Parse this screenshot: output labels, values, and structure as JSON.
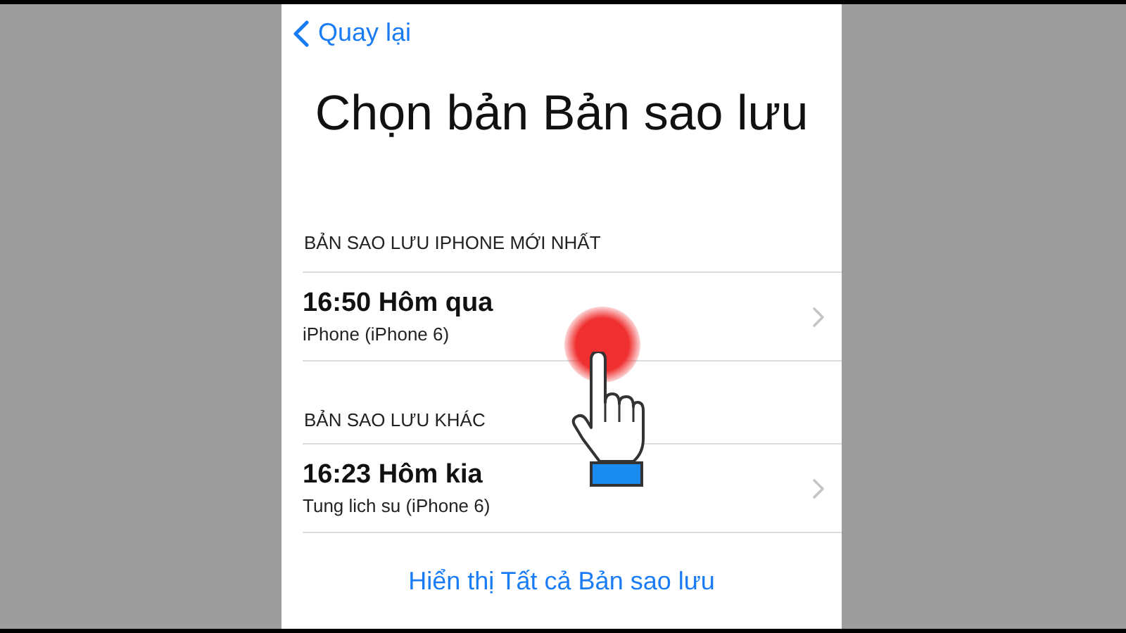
{
  "back_button": {
    "label": "Quay lại"
  },
  "title": "Chọn bản Bản sao lưu",
  "sections": [
    {
      "header": "BẢN SAO LƯU IPHONE MỚI NHẤT",
      "rows": [
        {
          "title": "16:50 Hôm qua",
          "subtitle": "iPhone (iPhone 6)"
        }
      ]
    },
    {
      "header": "BẢN SAO LƯU KHÁC",
      "rows": [
        {
          "title": "16:23 Hôm kia",
          "subtitle": "Tung lich su (iPhone 6)"
        }
      ]
    }
  ],
  "show_all_link": "Hiển thị Tất cả Bản sao lưu"
}
